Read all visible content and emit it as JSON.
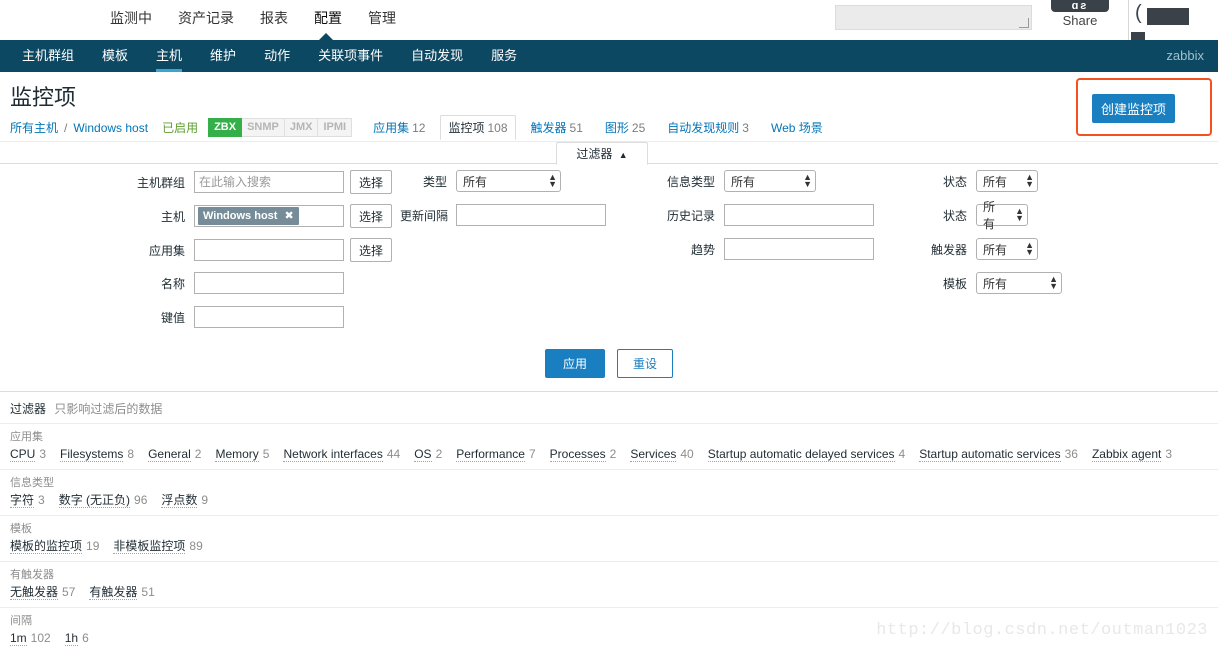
{
  "topmenu": {
    "items": [
      {
        "label": "监测中",
        "active": false
      },
      {
        "label": "资产记录",
        "active": false
      },
      {
        "label": "报表",
        "active": false
      },
      {
        "label": "配置",
        "active": true
      },
      {
        "label": "管理",
        "active": false
      }
    ],
    "search_value": "",
    "share_label": "Share",
    "share_glyphs": "ɑƨ"
  },
  "navbar": {
    "items": [
      {
        "label": "主机群组",
        "active": false
      },
      {
        "label": "模板",
        "active": false
      },
      {
        "label": "主机",
        "active": true
      },
      {
        "label": "维护",
        "active": false
      },
      {
        "label": "动作",
        "active": false
      },
      {
        "label": "关联项事件",
        "active": false
      },
      {
        "label": "自动发现",
        "active": false
      },
      {
        "label": "服务",
        "active": false
      }
    ],
    "user": "zabbix",
    "bg_color": "#0d4862",
    "active_underline_color": "#3ba5d1"
  },
  "page": {
    "title": "监控项",
    "create_button": "创建监控项",
    "highlight_color": "#f4511e",
    "accent_color": "#1a7fc1"
  },
  "breadcrumb": {
    "all_hosts": "所有主机",
    "separator": "/",
    "host": "Windows host",
    "status": "已启用",
    "badges": [
      {
        "label": "ZBX",
        "active": true
      },
      {
        "label": "SNMP",
        "active": false
      },
      {
        "label": "JMX",
        "active": false
      },
      {
        "label": "IPMI",
        "active": false
      }
    ],
    "tabs": [
      {
        "label": "应用集",
        "count": "12",
        "selected": false
      },
      {
        "label": "监控项",
        "count": "108",
        "selected": true
      },
      {
        "label": "触发器",
        "count": "51",
        "selected": false
      },
      {
        "label": "图形",
        "count": "25",
        "selected": false
      },
      {
        "label": "自动发现规则",
        "count": "3",
        "selected": false
      },
      {
        "label": "Web 场景",
        "count": "",
        "selected": false
      }
    ]
  },
  "filter": {
    "tab_label": "过滤器",
    "tab_arrow": "▲",
    "host_groups": {
      "label": "主机群组",
      "value": "",
      "placeholder": "在此输入搜索",
      "select_button": "选择"
    },
    "hosts": {
      "label": "主机",
      "chip": "Windows host",
      "chip_close": "✖",
      "select_button": "选择"
    },
    "application": {
      "label": "应用集",
      "value": "",
      "placeholder": "",
      "select_button": "选择"
    },
    "name": {
      "label": "名称",
      "value": "",
      "placeholder": ""
    },
    "key": {
      "label": "键值",
      "value": "",
      "placeholder": ""
    },
    "type": {
      "label": "类型",
      "value": "所有"
    },
    "update_interval": {
      "label": "更新间隔",
      "value": "",
      "placeholder": ""
    },
    "info_type": {
      "label": "信息类型",
      "value": "所有"
    },
    "history": {
      "label": "历史记录",
      "value": "",
      "placeholder": ""
    },
    "trends": {
      "label": "趋势",
      "value": "",
      "placeholder": ""
    },
    "state": {
      "label": "状态",
      "value": "所有"
    },
    "status": {
      "label": "状态",
      "value": "所有"
    },
    "triggers": {
      "label": "触发器",
      "value": "所有"
    },
    "template": {
      "label": "模板",
      "value": "所有"
    },
    "apply_button": "应用",
    "reset_button": "重设"
  },
  "subfilter": {
    "title": "过滤器",
    "subtitle": "只影响过滤后的数据",
    "blocks": [
      {
        "title": "应用集",
        "items": [
          {
            "label": "CPU",
            "count": "3"
          },
          {
            "label": "Filesystems",
            "count": "8"
          },
          {
            "label": "General",
            "count": "2"
          },
          {
            "label": "Memory",
            "count": "5"
          },
          {
            "label": "Network interfaces",
            "count": "44"
          },
          {
            "label": "OS",
            "count": "2"
          },
          {
            "label": "Performance",
            "count": "7"
          },
          {
            "label": "Processes",
            "count": "2"
          },
          {
            "label": "Services",
            "count": "40"
          },
          {
            "label": "Startup automatic delayed services",
            "count": "4"
          },
          {
            "label": "Startup automatic services",
            "count": "36"
          },
          {
            "label": "Zabbix agent",
            "count": "3"
          }
        ]
      },
      {
        "title": "信息类型",
        "items": [
          {
            "label": "字符",
            "count": "3"
          },
          {
            "label": "数字 (无正负)",
            "count": "96"
          },
          {
            "label": "浮点数",
            "count": "9"
          }
        ]
      },
      {
        "title": "模板",
        "items": [
          {
            "label": "模板的监控项",
            "count": "19"
          },
          {
            "label": "非模板监控项",
            "count": "89"
          }
        ]
      },
      {
        "title": "有触发器",
        "items": [
          {
            "label": "无触发器",
            "count": "57"
          },
          {
            "label": "有触发器",
            "count": "51"
          }
        ]
      },
      {
        "title": "间隔",
        "items": [
          {
            "label": "1m",
            "count": "102"
          },
          {
            "label": "1h",
            "count": "6"
          }
        ]
      }
    ]
  },
  "watermark": "http://blog.csdn.net/outman1023"
}
